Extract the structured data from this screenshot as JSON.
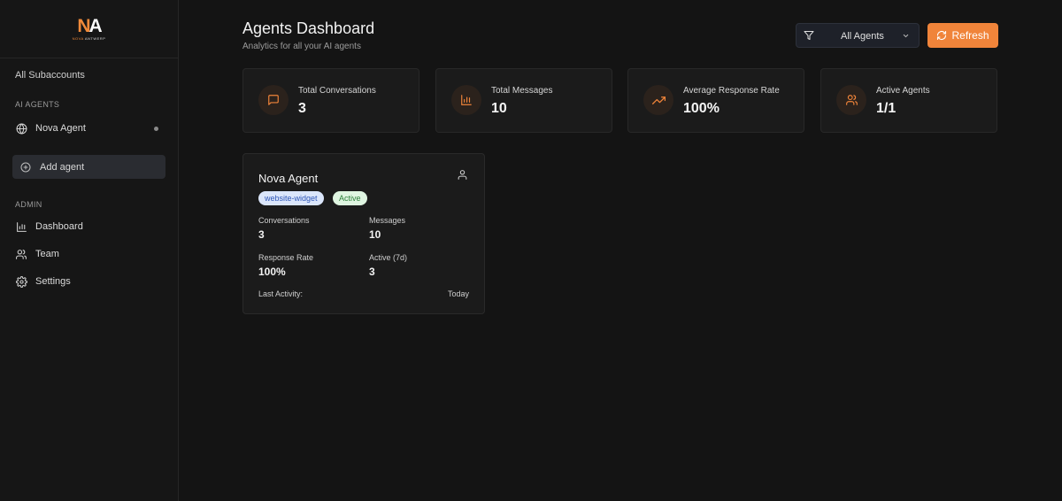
{
  "brand": {
    "logo_n": "N",
    "logo_a": "A",
    "logo_sub_nova": "NOVA",
    "logo_sub_rest": "ANTWERP",
    "accent": "#f0843a"
  },
  "sidebar": {
    "sub_accounts": "All Subaccounts",
    "ai_agents_label": "AI AGENTS",
    "agents": [
      {
        "label": "Nova Agent",
        "icon": "globe-icon",
        "status_dot": "#8a8a8a"
      }
    ],
    "add_agent_label": "Add agent",
    "admin_label": "ADMIN",
    "admin_items": [
      {
        "label": "Dashboard",
        "icon": "bar-chart-icon"
      },
      {
        "label": "Team",
        "icon": "users-icon"
      },
      {
        "label": "Settings",
        "icon": "gear-icon"
      }
    ]
  },
  "header": {
    "title": "Agents Dashboard",
    "subtitle": "Analytics for all your AI agents",
    "filter_value": "All Agents",
    "refresh_label": "Refresh"
  },
  "stats": [
    {
      "label": "Total Conversations",
      "value": "3",
      "icon": "message-square-icon"
    },
    {
      "label": "Total Messages",
      "value": "10",
      "icon": "bar-chart-icon"
    },
    {
      "label": "Average Response Rate",
      "value": "100%",
      "icon": "trending-up-icon"
    },
    {
      "label": "Active Agents",
      "value": "1/1",
      "icon": "users-icon"
    }
  ],
  "agent_card": {
    "name": "Nova Agent",
    "badges": [
      "website-widget",
      "Active"
    ],
    "metrics": [
      {
        "label": "Conversations",
        "value": "3"
      },
      {
        "label": "Messages",
        "value": "10"
      },
      {
        "label": "Response Rate",
        "value": "100%"
      },
      {
        "label": "Active (7d)",
        "value": "3"
      }
    ],
    "last_activity_label": "Last Activity:",
    "last_activity_value": "Today"
  }
}
